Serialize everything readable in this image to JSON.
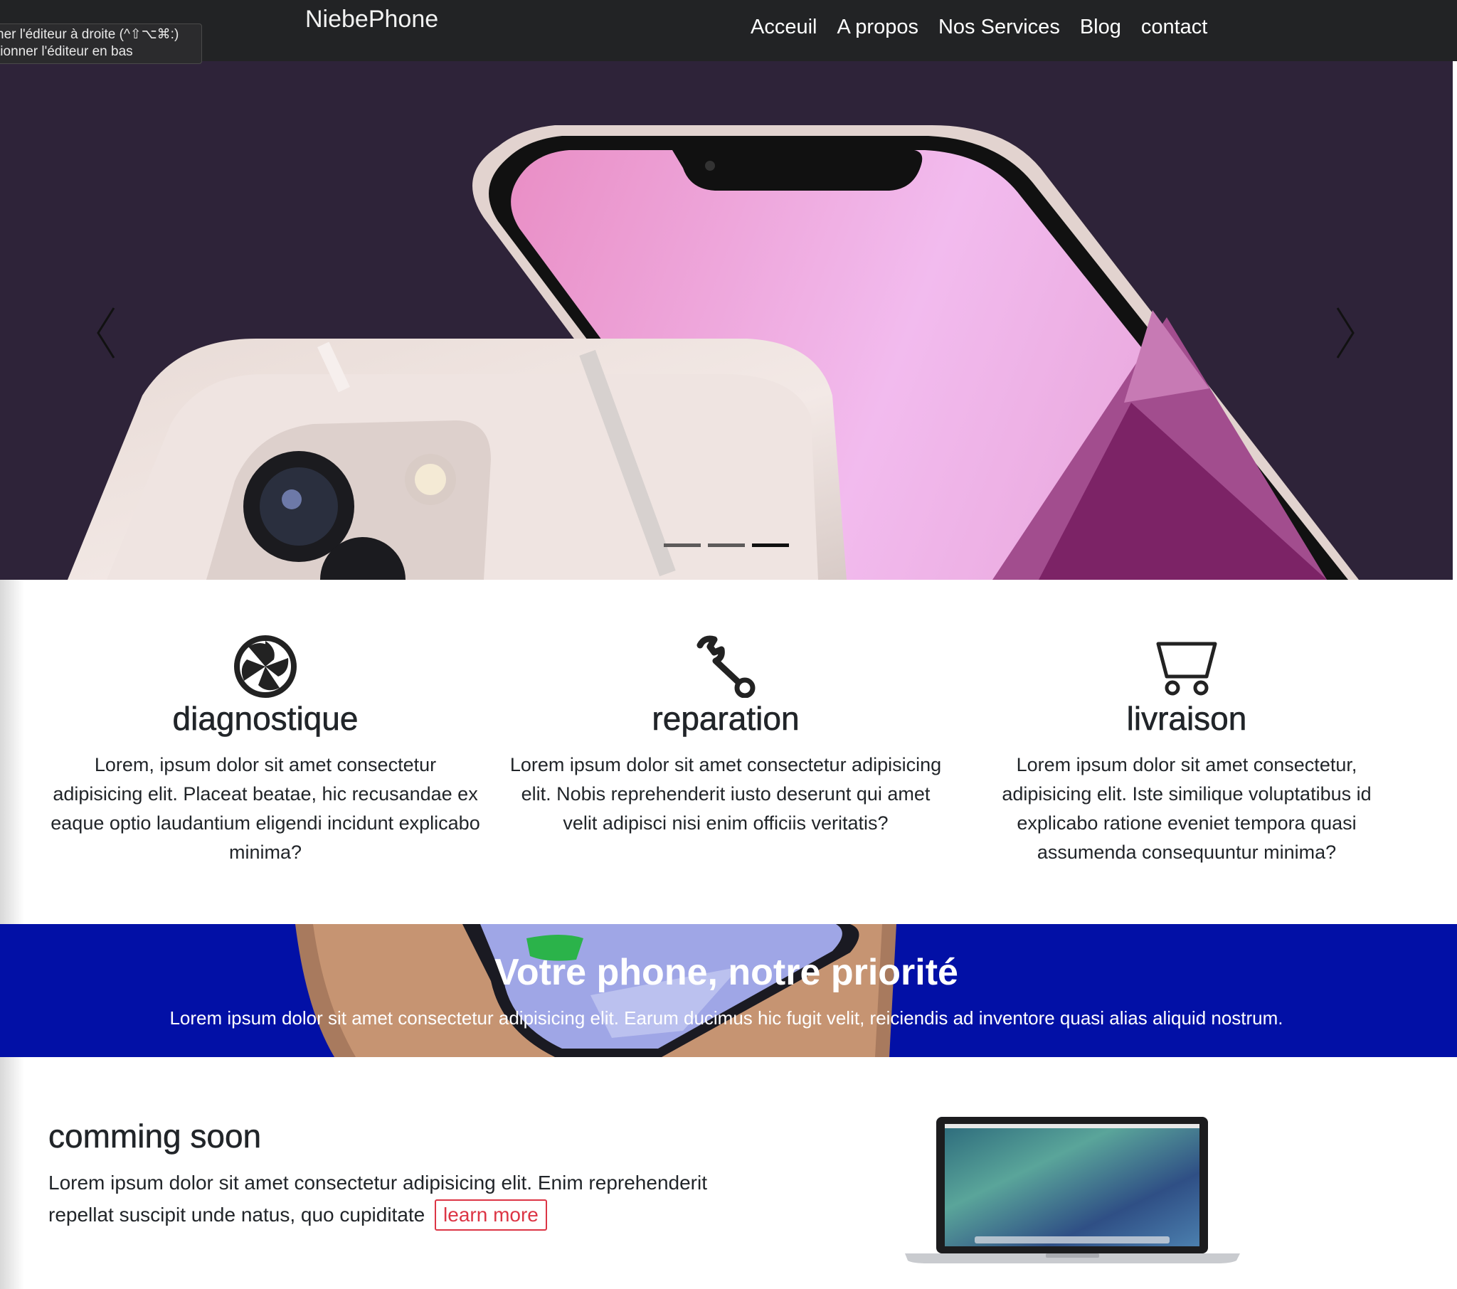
{
  "navbar": {
    "brand": "NiebePhone",
    "links": [
      "Acceuil",
      "A propos",
      "Nos Services",
      "Blog",
      "contact"
    ]
  },
  "tooltip": {
    "line1": "ner l'éditeur à droite (^⇧⌥⌘:)",
    "line2": "tionner l'éditeur en bas"
  },
  "carousel": {
    "slide_count": 3,
    "active_index": 2
  },
  "features": [
    {
      "icon": "aperture-icon",
      "title": "diagnostique",
      "text": "Lorem, ipsum dolor sit amet consectetur adipisicing elit. Placeat beatae, hic recusandae ex eaque optio laudantium eligendi incidunt explicabo minima?"
    },
    {
      "icon": "wrench-icon",
      "title": "reparation",
      "text": "Lorem ipsum dolor sit amet consectetur adipisicing elit. Nobis reprehenderit iusto deserunt qui amet velit adipisci nisi enim officiis veritatis?"
    },
    {
      "icon": "cart-icon",
      "title": "livraison",
      "text": "Lorem ipsum dolor sit amet consectetur, adipisicing elit. Iste similique voluptatibus id explicabo ratione eveniet tempora quasi assumenda consequuntur minima?"
    }
  ],
  "banner": {
    "title": "Votre phone, notre priorité",
    "text": "Lorem ipsum dolor sit amet consectetur adipisicing elit. Earum ducimus hic fugit velit, reiciendis ad inventore quasi alias aliquid nostrum."
  },
  "coming_soon": {
    "title": "comming soon",
    "text": "Lorem ipsum dolor sit amet consectetur adipisicing elit. Enim reprehenderit repellat suscipit unde natus, quo cupiditate",
    "button": "learn more"
  },
  "colors": {
    "navbar_bg": "#222325",
    "hero_bg": "#2e2339",
    "banner_bg": "#0210a6",
    "accent_red": "#dc3545"
  }
}
